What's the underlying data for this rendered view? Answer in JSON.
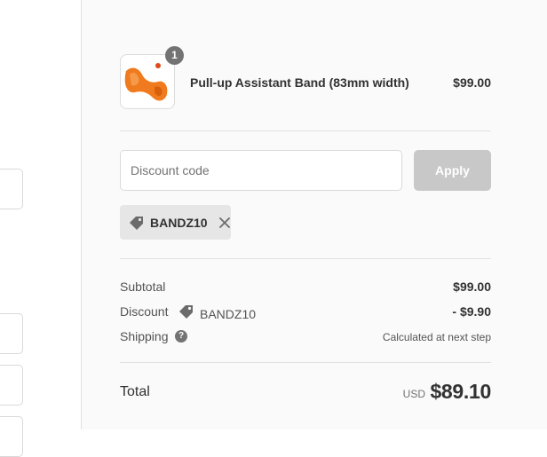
{
  "order_summary": {
    "product": {
      "name": "Pull-up Assistant Band (83mm width)",
      "price": "$99.00",
      "quantity": "1",
      "image_icon": "orange-band-image",
      "image_color": "#f07a1e"
    },
    "discount": {
      "placeholder": "Discount code",
      "value": "",
      "apply_label": "Apply",
      "applied_code": "BANDZ10",
      "tag_icon": "tag-icon",
      "remove_icon": "close-icon"
    },
    "summary": {
      "subtotal_label": "Subtotal",
      "subtotal_value": "$99.00",
      "discount_label": "Discount",
      "discount_code": "BANDZ10",
      "discount_value": "- $9.90",
      "shipping_label": "Shipping",
      "shipping_help": "?",
      "shipping_value": "Calculated at next step"
    },
    "total": {
      "label": "Total",
      "currency": "USD",
      "value": "$89.10"
    }
  },
  "colors": {
    "panel_background": "#fafafa",
    "apply_button_disabled": "#c8c8c8",
    "chip_background": "#e6e6e6",
    "badge": "#737373"
  }
}
